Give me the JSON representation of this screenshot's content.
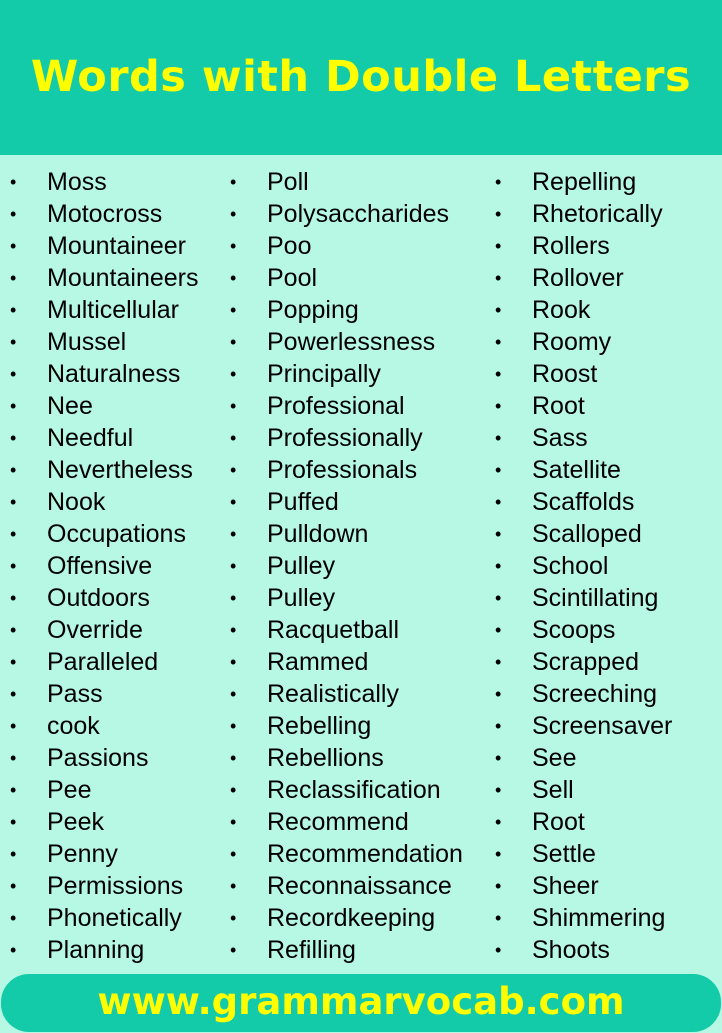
{
  "header": {
    "title": "Words with Double Letters"
  },
  "colors": {
    "header_bg": "#13cba8",
    "body_bg": "#b6f8e3",
    "title_text": "#ffff00"
  },
  "bullet": "•",
  "columns": [
    [
      "Moss",
      "Motocross",
      "Mountaineer",
      "Mountaineers",
      "Multicellular",
      "Mussel",
      "Naturalness",
      "Nee",
      "Needful",
      "Nevertheless",
      "Nook",
      " Occupations",
      "Offensive",
      "Outdoors",
      "Override",
      "Paralleled",
      "Pass",
      "cook",
      "Passions",
      "Pee",
      "Peek",
      "Penny",
      "Permissions",
      "Phonetically",
      "Planning"
    ],
    [
      "Poll",
      "Polysaccharides",
      "Poo",
      "Pool",
      "Popping",
      "Powerlessness",
      "Principally",
      "Professional",
      "Professionally",
      "Professionals",
      "Puffed",
      "Pulldown",
      "Pulley",
      "Pulley",
      "Racquetball",
      "Rammed",
      "Realistically",
      "Rebelling",
      "Rebellions",
      "Reclassification",
      "Recommend",
      "Recommendation",
      "Reconnaissance",
      "Recordkeeping",
      "Refilling"
    ],
    [
      "Repelling",
      "Rhetorically",
      "Rollers",
      "Rollover",
      "Rook",
      "Roomy",
      "Roost",
      "Root",
      "Sass",
      "Satellite",
      "Scaffolds",
      "Scalloped",
      "School",
      "Scintillating",
      "Scoops",
      "Scrapped",
      "Screeching",
      "Screensaver",
      "See",
      "Sell",
      "Root",
      "Settle",
      "Sheer",
      "Shimmering",
      "Shoots"
    ]
  ],
  "footer": {
    "url": "www.grammarvocab.com"
  }
}
